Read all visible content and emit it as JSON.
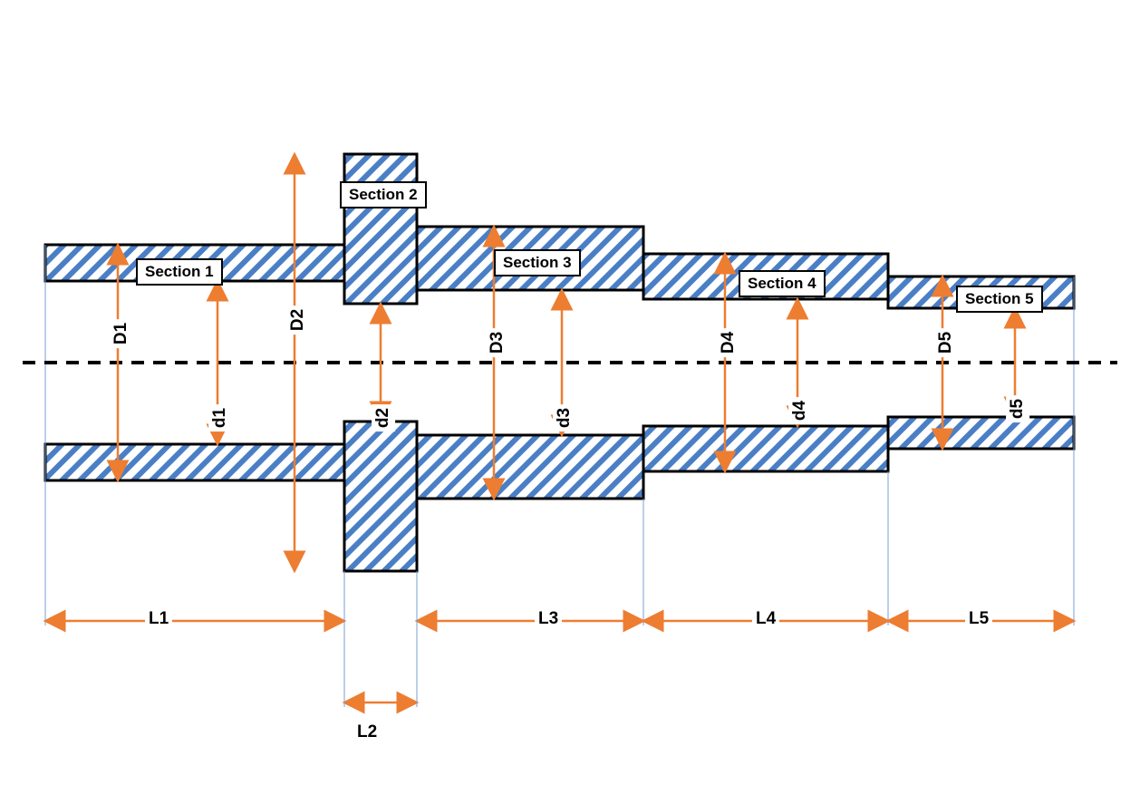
{
  "sections": {
    "s1": "Section 1",
    "s2": "Section 2",
    "s3": "Section 3",
    "s4": "Section 4",
    "s5": "Section 5"
  },
  "outer_dia": {
    "D1": "D1",
    "D2": "D2",
    "D3": "D3",
    "D4": "D4",
    "D5": "D5"
  },
  "inner_dia": {
    "d1": "d1",
    "d2": "d2",
    "d3": "d3",
    "d4": "d4",
    "d5": "d5"
  },
  "lengths": {
    "L1": "L1",
    "L2": "L2",
    "L3": "L3",
    "L4": "L4",
    "L5": "L5"
  },
  "chart_data": {
    "type": "diagram",
    "description": "Stepped hollow shaft cross-section with 5 sections",
    "axis": "horizontal centerline (dashed)",
    "sections": [
      {
        "id": 1,
        "outer_dia": "D1",
        "inner_dia": "d1",
        "length": "L1"
      },
      {
        "id": 2,
        "outer_dia": "D2",
        "inner_dia": "d2",
        "length": "L2",
        "note": "flange (largest OD, smallest ID)"
      },
      {
        "id": 3,
        "outer_dia": "D3",
        "inner_dia": "d3",
        "length": "L3"
      },
      {
        "id": 4,
        "outer_dia": "D4",
        "inner_dia": "d4",
        "length": "L4"
      },
      {
        "id": 5,
        "outer_dia": "D5",
        "inner_dia": "d5",
        "length": "L5"
      }
    ]
  }
}
